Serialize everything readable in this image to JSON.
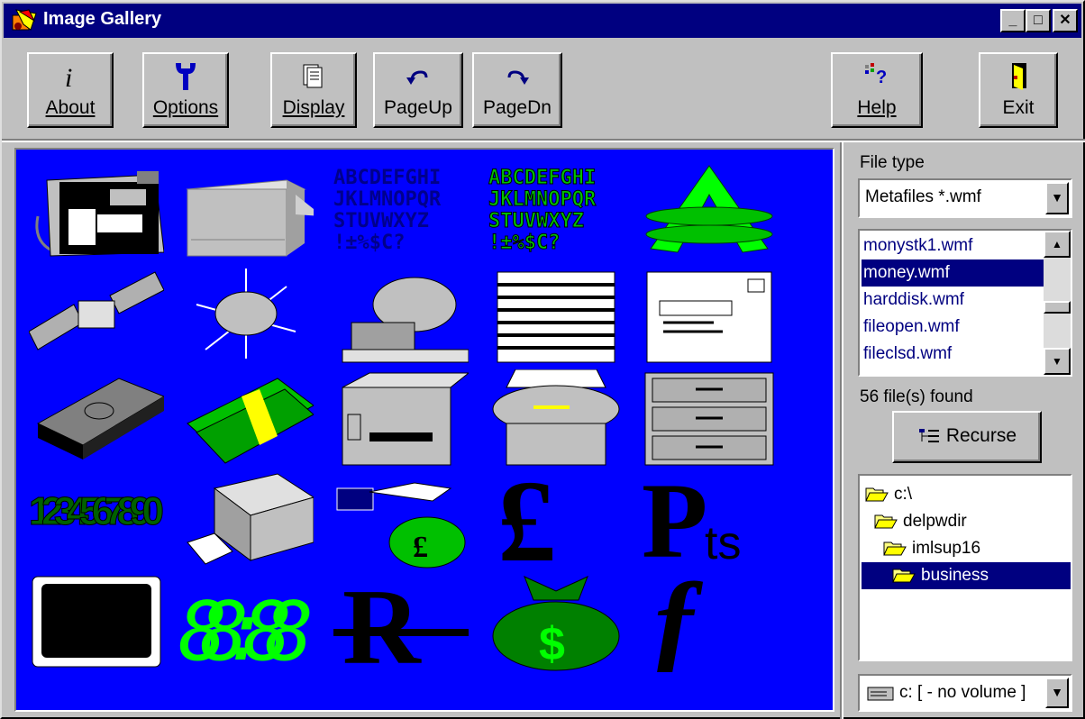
{
  "window": {
    "title": "Image Gallery"
  },
  "toolbar": {
    "about": "About",
    "options": "Options",
    "display": "Display",
    "pageup": "PageUp",
    "pagedn": "PageDn",
    "help": "Help",
    "exit": "Exit"
  },
  "right_panel": {
    "file_type_label": "File type",
    "file_type_value": "Metafiles *.wmf",
    "files": [
      "monystk1.wmf",
      "money.wmf",
      "harddisk.wmf",
      "fileopen.wmf",
      "fileclsd.wmf"
    ],
    "selected_file": "money.wmf",
    "files_found": "56 file(s) found",
    "recurse_label": "Recurse",
    "dirs": [
      "c:\\",
      "delpwdir",
      "imlsup16",
      "business"
    ],
    "selected_dir": "business",
    "drive": "c: [ - no volume ]"
  },
  "gallery": {
    "items": [
      "phone",
      "printer",
      "font-blue",
      "font-green",
      "peso",
      "satellite-panels",
      "satellite-sphere",
      "satellite-dish",
      "document",
      "envelope",
      "money-stack",
      "money-wad",
      "computer",
      "fax",
      "file-cabinet",
      "digits",
      "laser-printer",
      "money-bag-pound",
      "pound",
      "pesetas",
      "monitor",
      "clock",
      "rupee",
      "money-bag-dollar",
      "florin"
    ],
    "font_sample": "ABCDEFGHI JKLMNOPQR STUVWXYZ !±%$C?",
    "digits_text": "1234567890",
    "clock_text": "88:88"
  }
}
